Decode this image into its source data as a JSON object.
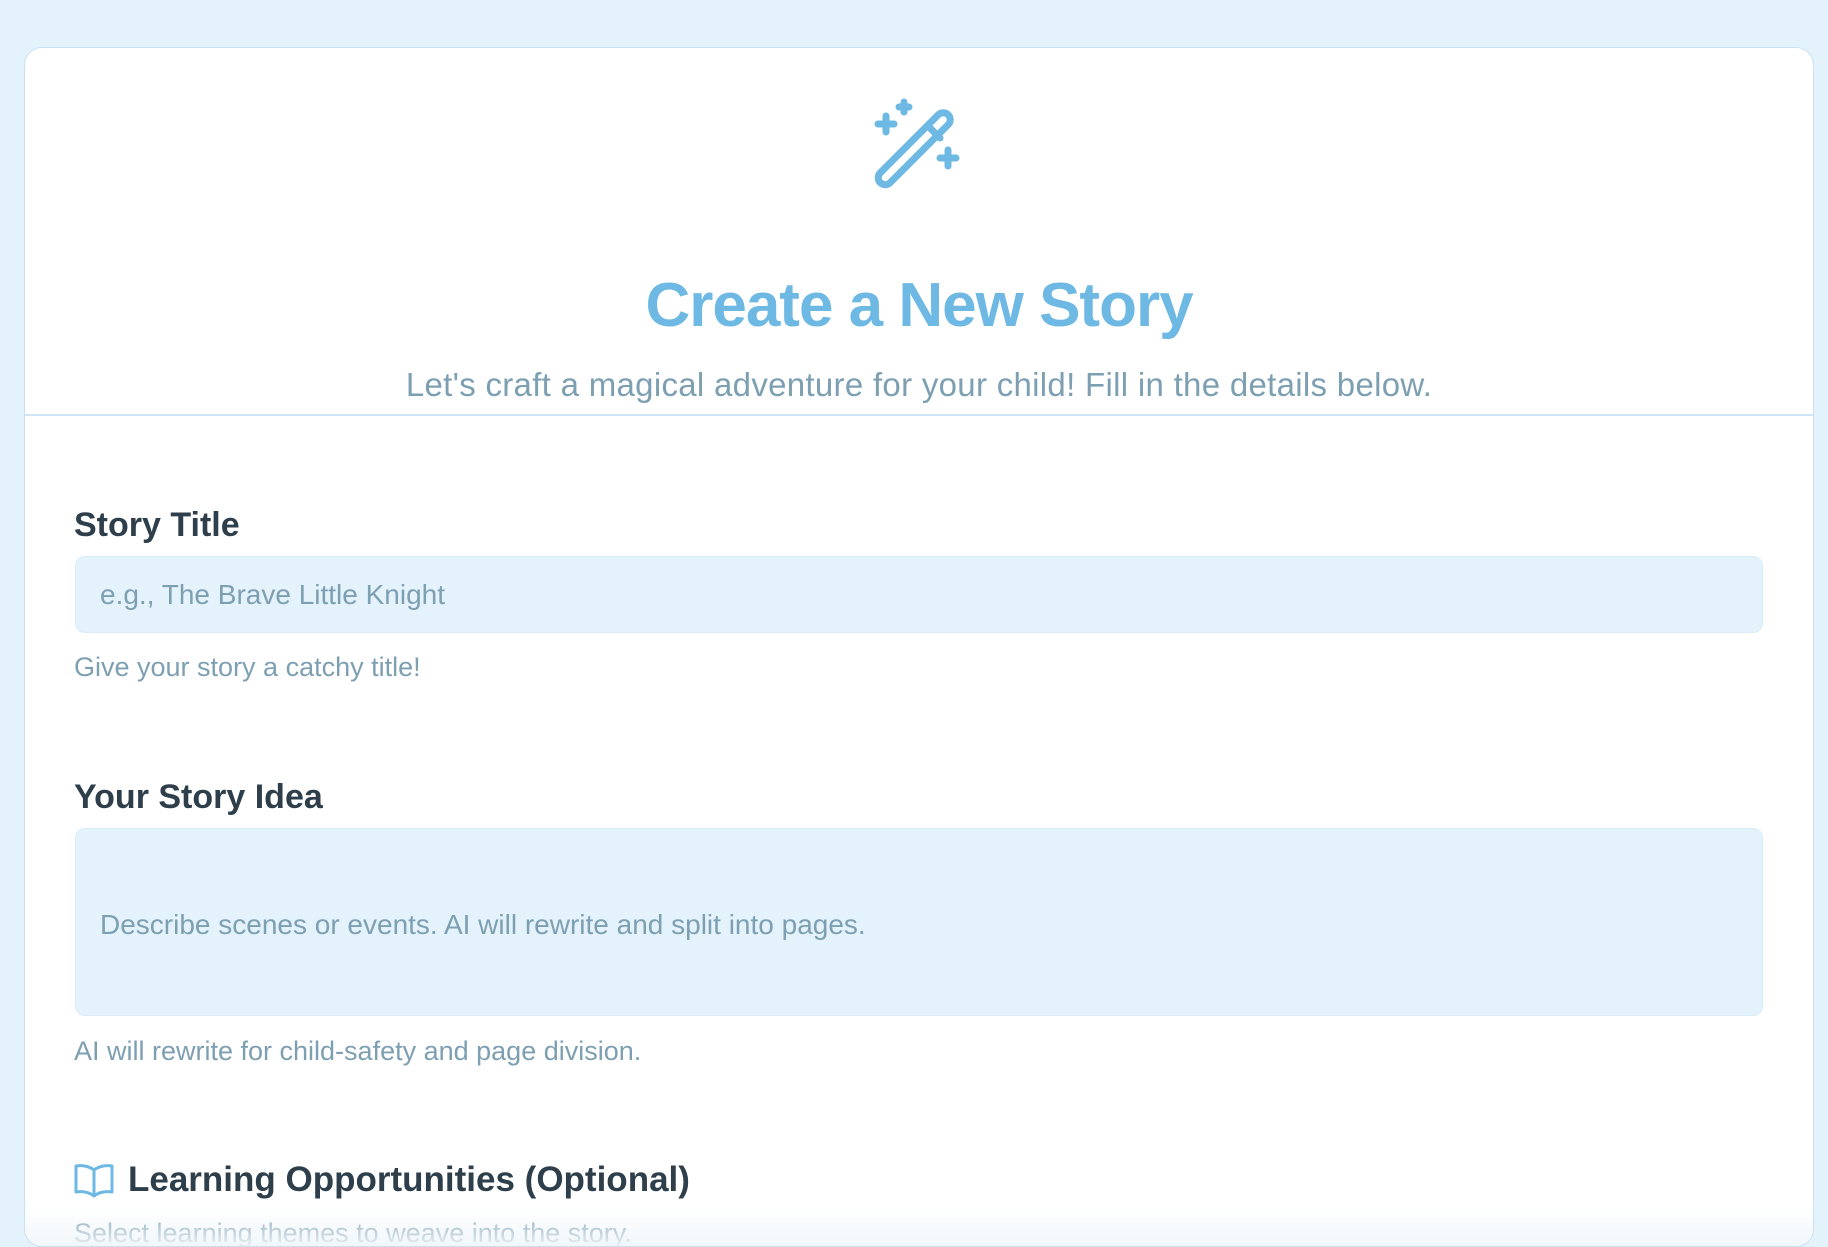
{
  "header": {
    "icon": "magic-wand-icon",
    "title": "Create a New Story",
    "subtitle": "Let's craft a magical adventure for your child! Fill in the details below."
  },
  "form": {
    "title_field": {
      "label": "Story Title",
      "placeholder": "e.g., The Brave Little Knight",
      "value": "",
      "helper": "Give your story a catchy title!"
    },
    "idea_field": {
      "label": "Your Story Idea",
      "placeholder": "Describe scenes or events. AI will rewrite and split into pages.",
      "value": "",
      "helper": "AI will rewrite for child-safety and page division."
    },
    "learning_section": {
      "icon": "open-book-icon",
      "title": "Learning Opportunities (Optional)",
      "description": "Select learning themes to weave into the story."
    }
  },
  "colors": {
    "page_background": "#e4f2fc",
    "accent": "#6eb8e4",
    "heading_text": "#2e3f4b",
    "muted_text": "#7d9fb2",
    "input_background": "#e4f2fc"
  }
}
